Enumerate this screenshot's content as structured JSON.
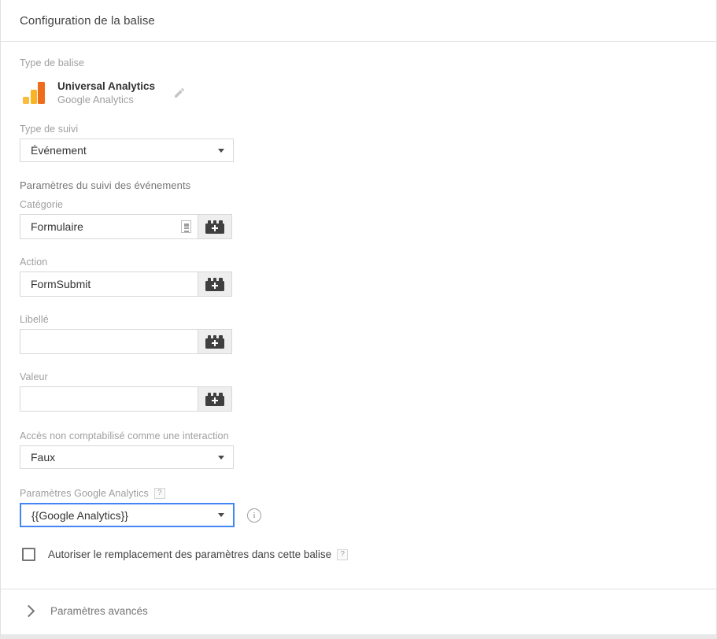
{
  "header": {
    "title": "Configuration de la balise"
  },
  "tag_type": {
    "label": "Type de balise",
    "name": "Universal Analytics",
    "vendor": "Google Analytics",
    "edit_icon": "pencil-icon"
  },
  "track_type": {
    "label": "Type de suivi",
    "value": "Événement"
  },
  "event_section": {
    "label": "Paramètres du suivi des événements",
    "fields": [
      {
        "label": "Catégorie",
        "value": "Formulaire",
        "has_suggest": true
      },
      {
        "label": "Action",
        "value": "FormSubmit",
        "has_suggest": false
      },
      {
        "label": "Libellé",
        "value": "",
        "has_suggest": false
      },
      {
        "label": "Valeur",
        "value": "",
        "has_suggest": false
      }
    ]
  },
  "non_interaction": {
    "label": "Accès non comptabilisé comme une interaction",
    "value": "Faux"
  },
  "ga_settings": {
    "label": "Paramètres Google Analytics",
    "help_badge": "?",
    "value": "{{Google Analytics}}",
    "info_icon": "info-icon",
    "focused": true
  },
  "override_checkbox": {
    "label": "Autoriser le remplacement des paramètres dans cette balise",
    "help_badge": "?",
    "checked": false
  },
  "advanced": {
    "label": "Paramètres avancés",
    "expand_icon": "chevron-right-icon"
  },
  "colors": {
    "focus_blue": "#4285f4",
    "ga_yellow": "#f9bd3b",
    "ga_orange": "#ef6c1a",
    "border_gray": "#d8d8d8",
    "label_gray": "#9e9e9e"
  }
}
